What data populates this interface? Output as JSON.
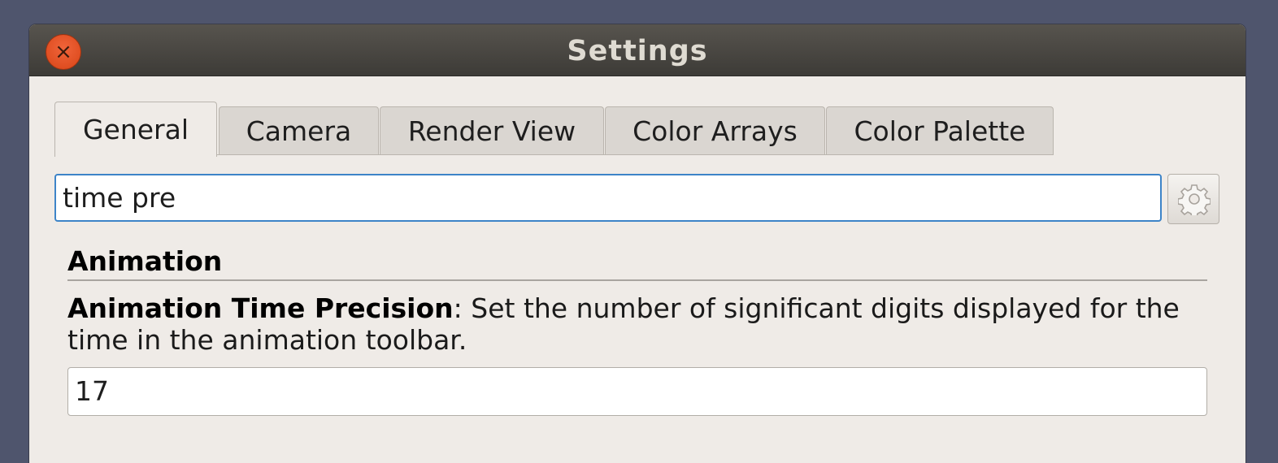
{
  "window": {
    "title": "Settings",
    "close_glyph": "×"
  },
  "tabs": [
    {
      "label": "General",
      "active": true
    },
    {
      "label": "Camera",
      "active": false
    },
    {
      "label": "Render View",
      "active": false
    },
    {
      "label": "Color Arrays",
      "active": false
    },
    {
      "label": "Color Palette",
      "active": false
    }
  ],
  "search": {
    "value": "time pre",
    "options_icon": "gear-icon"
  },
  "section": {
    "heading": "Animation",
    "setting_name": "Animation Time Precision",
    "setting_description": ": Set the number of significant digits displayed for the time in the animation toolbar.",
    "setting_value": "17"
  },
  "colors": {
    "desktop": "#4f556d",
    "titlebar": "#3d3b37",
    "close_button": "#e5532a",
    "focus_border": "#3d84c8"
  }
}
